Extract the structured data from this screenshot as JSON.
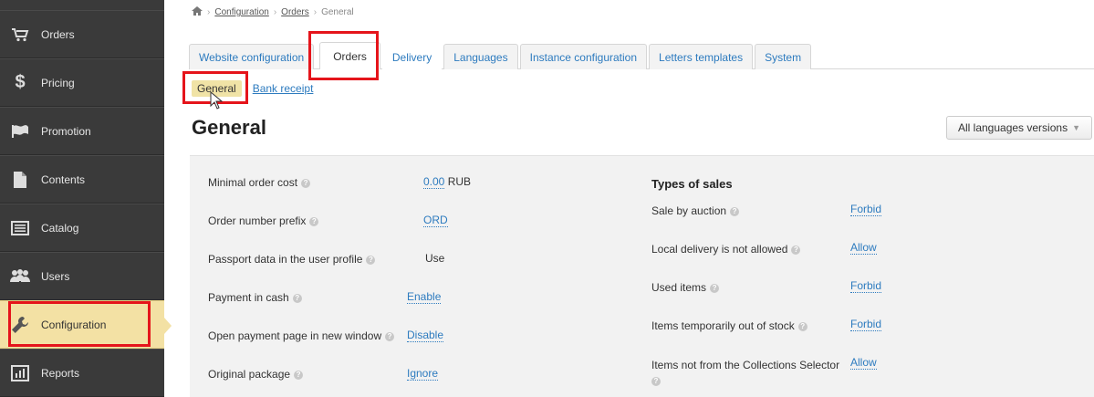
{
  "sidebar": {
    "items": [
      {
        "label": "Orders",
        "icon": "cart-icon"
      },
      {
        "label": "Pricing",
        "icon": "dollar-icon"
      },
      {
        "label": "Promotion",
        "icon": "flag-icon"
      },
      {
        "label": "Contents",
        "icon": "document-icon"
      },
      {
        "label": "Catalog",
        "icon": "list-icon"
      },
      {
        "label": "Users",
        "icon": "users-icon"
      },
      {
        "label": "Configuration",
        "icon": "wrench-icon"
      },
      {
        "label": "Reports",
        "icon": "chart-icon"
      }
    ],
    "active": "Configuration"
  },
  "breadcrumb": {
    "home_icon": "home-icon",
    "items": [
      "Configuration",
      "Orders",
      "General"
    ]
  },
  "tabs": [
    "Website configuration",
    "Orders",
    "Delivery",
    "Languages",
    "Instance configuration",
    "Letters templates",
    "System"
  ],
  "subtabs": {
    "general": "General",
    "bank_receipt": "Bank receipt"
  },
  "page_title": "General",
  "lang_button": "All languages versions",
  "left_settings": [
    {
      "label": "Minimal order cost",
      "value": "0.00",
      "suffix": "RUB"
    },
    {
      "label": "Order number prefix",
      "value": "ORD"
    },
    {
      "label": "Passport data in the user profile",
      "value": "Use"
    },
    {
      "label": "Payment in cash",
      "value": "Enable"
    },
    {
      "label": "Open payment page in new window",
      "value": "Disable"
    },
    {
      "label": "Original package",
      "value": "Ignore"
    }
  ],
  "types_of_sales": {
    "title": "Types of sales",
    "items": [
      {
        "label": "Sale by auction",
        "value": "Forbid"
      },
      {
        "label": "Local delivery is not allowed",
        "value": "Allow"
      },
      {
        "label": "Used items",
        "value": "Forbid"
      },
      {
        "label": "Items temporarily out of stock",
        "value": "Forbid"
      },
      {
        "label": "Items not from the Collections Selector",
        "value": "Allow"
      }
    ]
  },
  "colors": {
    "sidebar_bg": "#3a3a3a",
    "active_bg": "#f3e1a4",
    "link": "#2d7bbf",
    "highlight": "#e5141b"
  }
}
